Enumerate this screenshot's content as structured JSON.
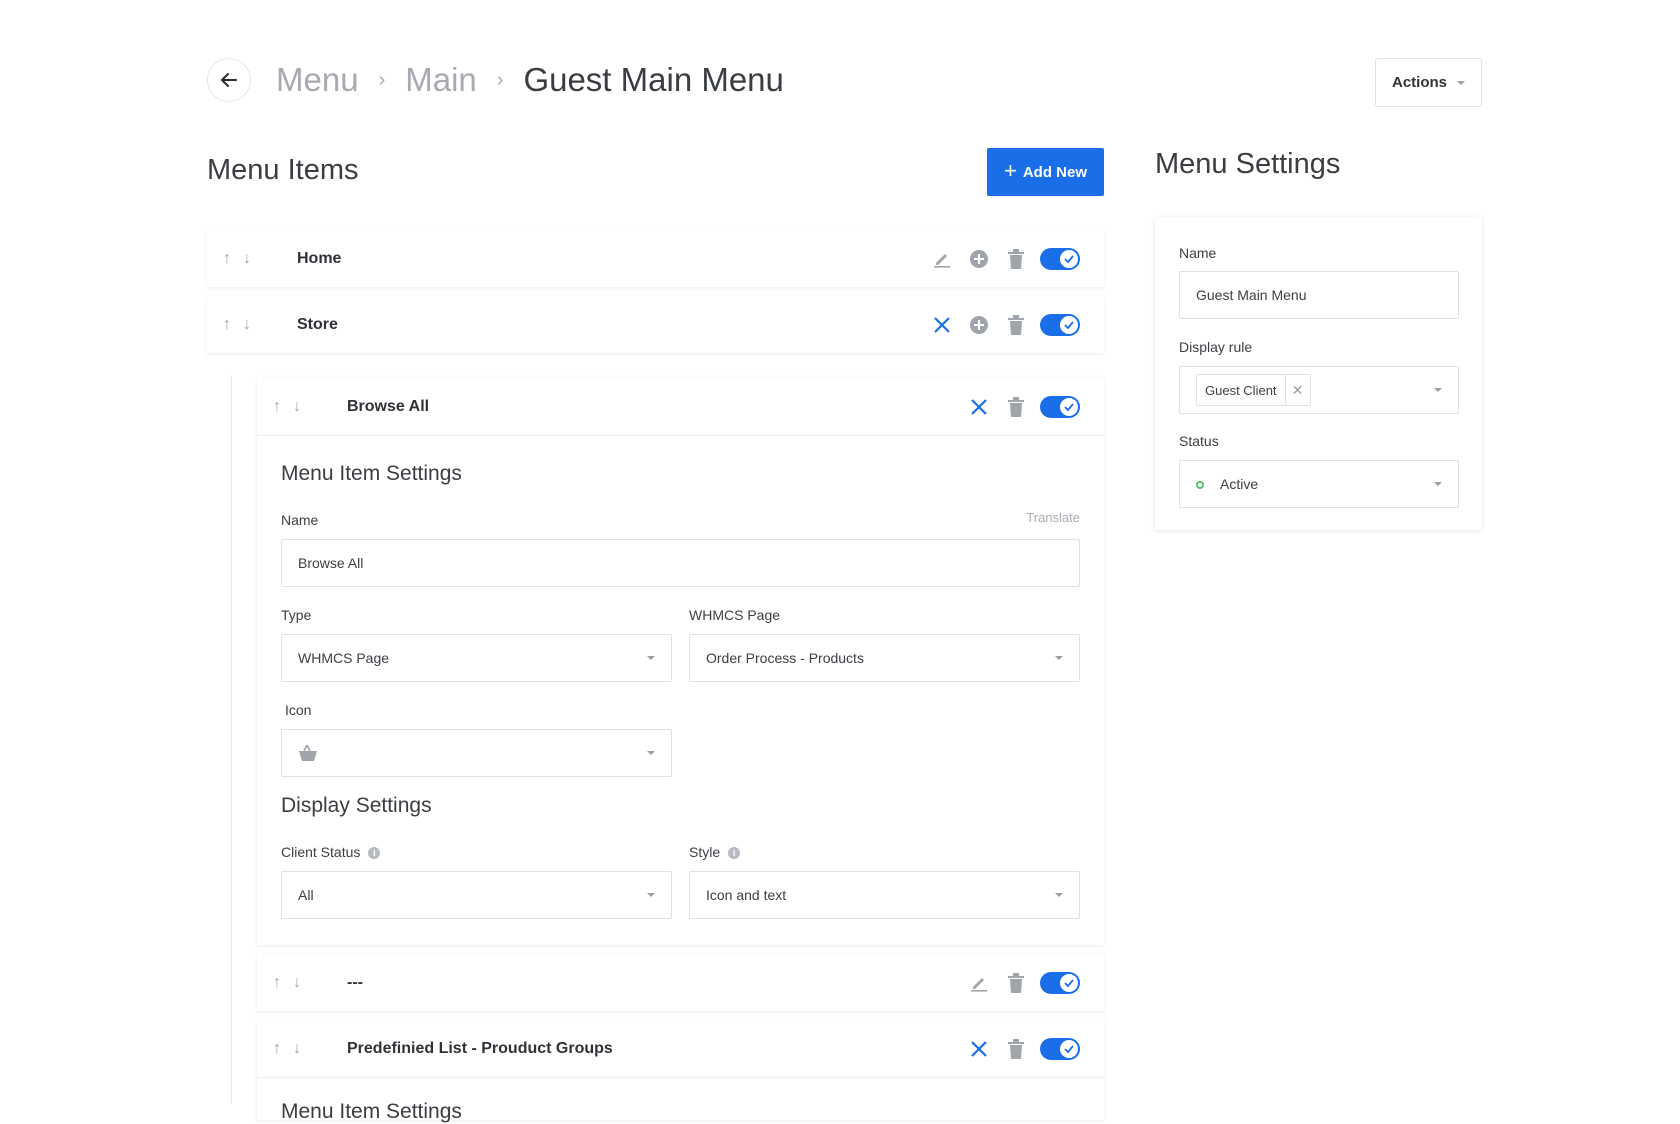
{
  "header": {
    "breadcrumb": [
      "Menu",
      "Main",
      "Guest Main Menu"
    ],
    "actions_label": "Actions"
  },
  "menu_items": {
    "title": "Menu Items",
    "add_new_label": "Add New",
    "rows": [
      {
        "label": "Home",
        "enabled": true
      },
      {
        "label": "Store",
        "enabled": true
      },
      {
        "label": "Browse All",
        "enabled": true
      },
      {
        "label": "---",
        "enabled": true
      },
      {
        "label": "Predefinied List - Prouduct Groups",
        "enabled": true
      }
    ]
  },
  "item_settings": {
    "title": "Menu Item Settings",
    "name_label": "Name",
    "translate_label": "Translate",
    "name_value": "Browse All",
    "type_label": "Type",
    "type_value": "WHMCS Page",
    "whmcs_page_label": "WHMCS Page",
    "whmcs_page_value": "Order Process - Products",
    "icon_label": "Icon",
    "icon_value": "basket-icon",
    "display_title": "Display Settings",
    "client_status_label": "Client Status",
    "client_status_value": "All",
    "style_label": "Style",
    "style_value": "Icon and text",
    "next_panel_title_partial": "Menu Item Settings"
  },
  "menu_settings": {
    "title": "Menu Settings",
    "name_label": "Name",
    "name_value": "Guest Main Menu",
    "display_rule_label": "Display rule",
    "display_rule_tag": "Guest Client",
    "status_label": "Status",
    "status_value": "Active"
  },
  "colors": {
    "accent": "#1a6fe8",
    "status_active": "#5bc46a"
  }
}
